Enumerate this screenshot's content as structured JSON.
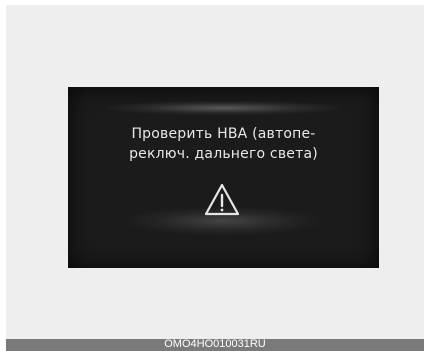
{
  "warning_display": {
    "message_line1": "Проверить HBA (автопе-",
    "message_line2": "реключ. дальнего света)",
    "icon": "warning-triangle-icon",
    "text_color": "#e8e8e8",
    "background_color": "#1b1b1b"
  },
  "caption": {
    "code": "OMO4HO010031RU"
  }
}
